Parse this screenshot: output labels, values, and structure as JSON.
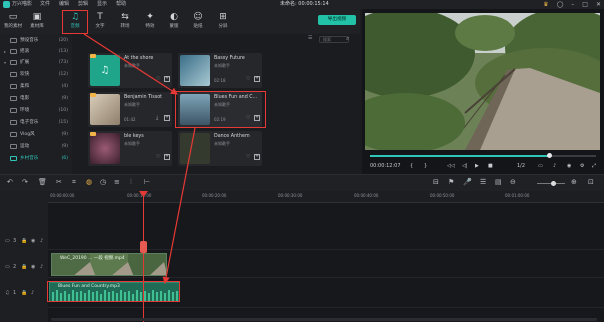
{
  "app": {
    "name": "万兴喵影",
    "project": "未命名: 00:00:15:14"
  },
  "menu": [
    "文件",
    "编辑",
    "剪辑",
    "显示",
    "帮助"
  ],
  "tools": [
    {
      "label": "我的素材",
      "icon": "folder-icon"
    },
    {
      "label": "素材库",
      "icon": "media-icon"
    },
    {
      "label": "音频",
      "icon": "music-note-icon"
    },
    {
      "label": "文字",
      "icon": "text-icon"
    },
    {
      "label": "转场",
      "icon": "transition-icon"
    },
    {
      "label": "特效",
      "icon": "effects-icon"
    },
    {
      "label": "蒙版",
      "icon": "mask-icon"
    },
    {
      "label": "贴纸",
      "icon": "sticker-icon"
    },
    {
      "label": "分屏",
      "icon": "split-screen-icon"
    }
  ],
  "export_label": "导出视频",
  "sidebar": [
    {
      "name": "预设音乐",
      "count": "(20)"
    },
    {
      "name": "摇滚",
      "count": "(13)"
    },
    {
      "name": "扩展",
      "count": "(73)"
    },
    {
      "name": "欢快",
      "count": "(12)"
    },
    {
      "name": "柔和",
      "count": "(4)"
    },
    {
      "name": "电影",
      "count": "(9)"
    },
    {
      "name": "环境",
      "count": "(10)"
    },
    {
      "name": "电子音乐",
      "count": "(15)"
    },
    {
      "name": "Vlog风",
      "count": "(9)"
    },
    {
      "name": "运动",
      "count": "(9)"
    },
    {
      "name": "乡村音乐",
      "count": "(6)"
    }
  ],
  "search": {
    "placeholder": "搜索"
  },
  "cards": [
    {
      "title": "At the shore",
      "sub": "未知歌手",
      "dur": "",
      "color": "#1fa58a"
    },
    {
      "title": "Bassy Future",
      "sub": "未知歌手",
      "dur": "02:18",
      "color": "#3a6e88"
    },
    {
      "title": "Benjamin Tissot",
      "sub": "未知歌手",
      "dur": "01:42",
      "color": "#c9bba8"
    },
    {
      "title": "Blues Fun and C...",
      "sub": "未知歌手",
      "dur": "02:19",
      "color": "#5d7f93"
    },
    {
      "title": "ble keys",
      "sub": "未知歌手",
      "dur": "",
      "color": "#7a3d52"
    },
    {
      "title": "Dance Anthem",
      "sub": "未知歌手",
      "dur": "",
      "color": "#343a2e"
    }
  ],
  "player": {
    "time": "00:00:12:07",
    "ratio": "1/2",
    "progress": 0.79
  },
  "ruler": [
    "00:00:00:00",
    "00:00:10:00",
    "00:00:20:00",
    "00:00:30:00",
    "00:00:40:00",
    "00:00:50:00",
    "00:01:00:00"
  ],
  "clips": {
    "video": "WeC_20190 ... 一段 视频.mp4",
    "audio": "Blues Fun and Country.mp3"
  },
  "track_labels": {
    "t3": "3",
    "t2": "2",
    "t1": "1"
  }
}
